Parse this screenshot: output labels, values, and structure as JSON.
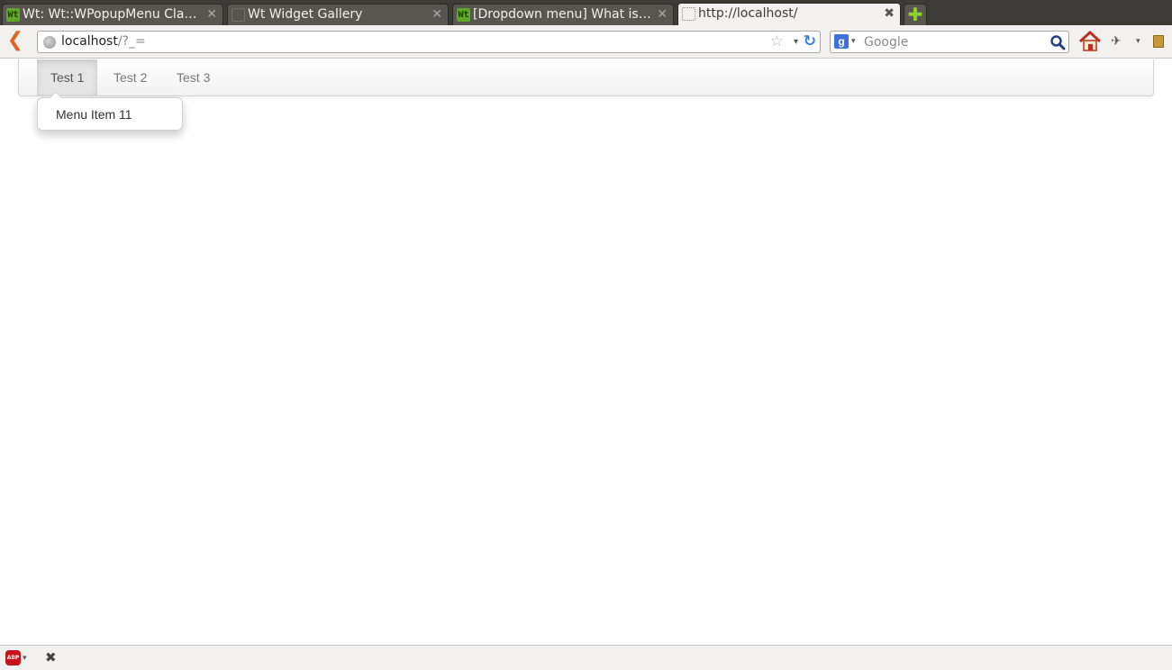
{
  "browser": {
    "tabs": [
      {
        "title": "Wt: Wt::WPopupMenu Clas…",
        "favicon": "wt-icon",
        "close": "✕",
        "active": false
      },
      {
        "title": "Wt Widget Gallery",
        "favicon": "blank-page-icon",
        "close": "✕",
        "active": false
      },
      {
        "title": "[Dropdown menu] What is a…",
        "favicon": "wt-icon",
        "close": "✕",
        "active": false
      },
      {
        "title": "http://localhost/",
        "favicon": "blank-page-icon",
        "close": "✖",
        "active": true
      }
    ],
    "new_tab_label": "✚",
    "url_host": "localhost",
    "url_rest": "/?_=",
    "search_placeholder": "Google",
    "search_engine_glyph": "g",
    "back_glyph": "❮",
    "star_glyph": "☆",
    "dropdown_glyph": "▾",
    "reload_glyph": "↻",
    "addon_glyph": "✈"
  },
  "page": {
    "menu": [
      {
        "label": "Test 1",
        "active": true
      },
      {
        "label": "Test 2",
        "active": false
      },
      {
        "label": "Test 3",
        "active": false
      }
    ],
    "dropdown_items": [
      "Menu Item 11"
    ]
  },
  "addon_bar": {
    "abp_label": "ABP",
    "close_glyph": "✖"
  },
  "colors": {
    "tabstrip_bg": "#3c3b37",
    "toolbar_bg": "#f2f1f0",
    "back_arrow": "#e0661e",
    "reload": "#3a82d6",
    "active_menu_bg": "#e5e5e5"
  }
}
